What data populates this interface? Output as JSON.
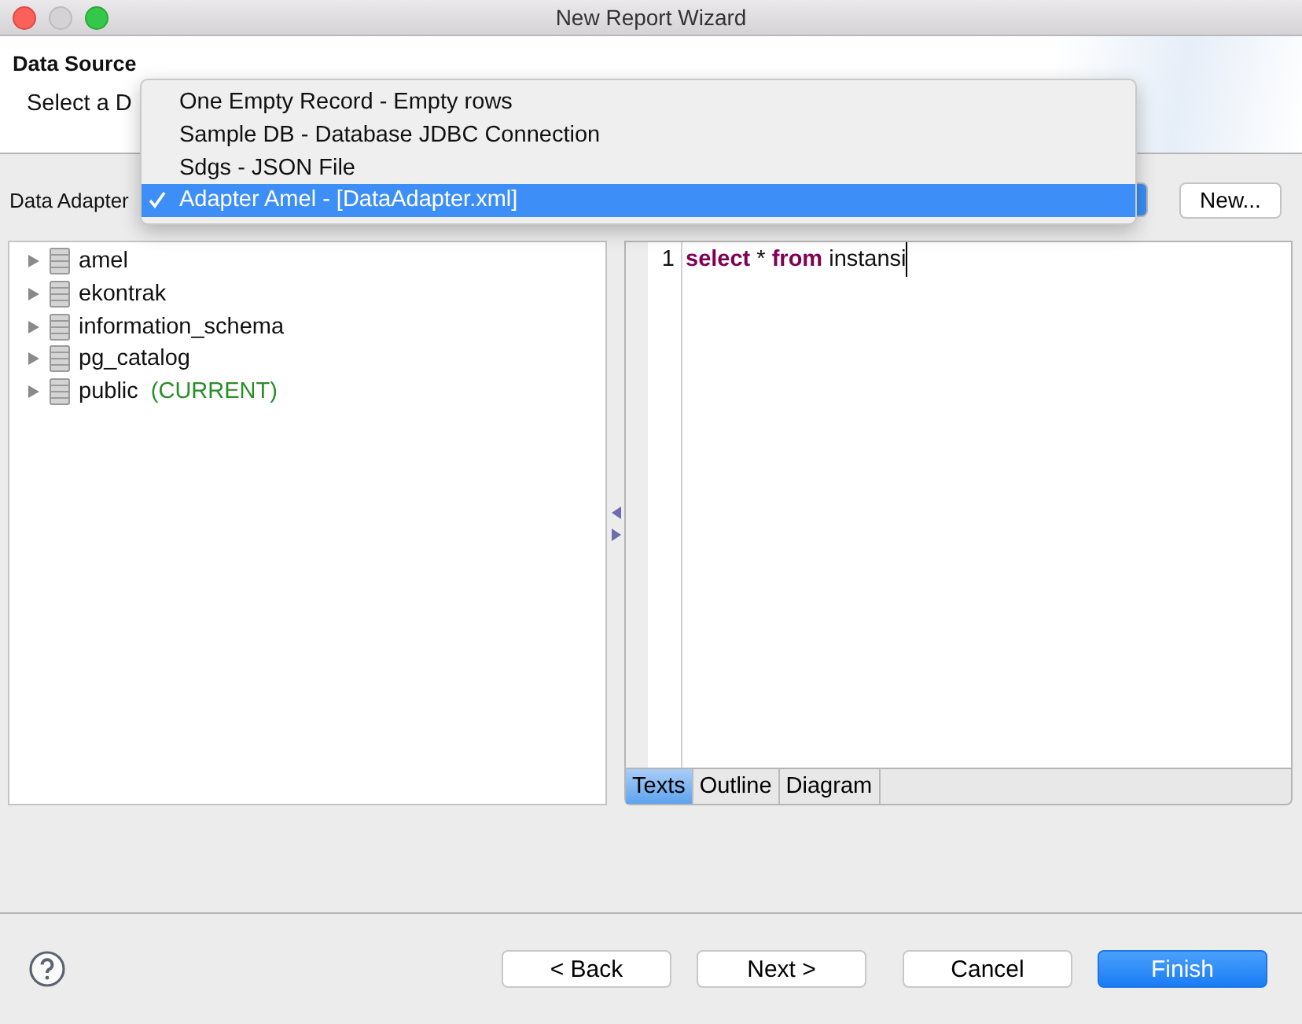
{
  "window": {
    "title": "New Report Wizard"
  },
  "header": {
    "title": "Data Source",
    "subtitle": "Select a D"
  },
  "adapter": {
    "label": "Data Adapter",
    "new_button": "New..."
  },
  "dropdown_menu": {
    "items": [
      {
        "label": "One Empty Record - Empty rows",
        "selected": false
      },
      {
        "label": "Sample DB - Database JDBC Connection",
        "selected": false
      },
      {
        "label": "Sdgs - JSON File",
        "selected": false
      },
      {
        "label": "Adapter Amel - [DataAdapter.xml]",
        "selected": true
      }
    ]
  },
  "schema_tree": {
    "items": [
      {
        "name": "amel",
        "expanded": false
      },
      {
        "name": "ekontrak",
        "expanded": false
      },
      {
        "name": "information_schema",
        "expanded": false
      },
      {
        "name": "pg_catalog",
        "expanded": false
      },
      {
        "name": "public",
        "tag": "(CURRENT)",
        "expanded": false
      }
    ]
  },
  "editor": {
    "lines": [
      {
        "number": "1",
        "tokens": [
          {
            "kind": "keyword",
            "text": "select"
          },
          {
            "kind": "text",
            "text": "*"
          },
          {
            "kind": "keyword",
            "text": "from"
          },
          {
            "kind": "text",
            "text": "instansi"
          }
        ]
      }
    ],
    "tabs": [
      {
        "label": "Texts",
        "selected": true
      },
      {
        "label": "Outline",
        "selected": false
      },
      {
        "label": "Diagram",
        "selected": false
      }
    ]
  },
  "buttons": [
    {
      "label": "< Back",
      "kind": "default"
    },
    {
      "label": "Next >",
      "kind": "default"
    },
    {
      "label": "Cancel",
      "kind": "default"
    },
    {
      "label": "Finish",
      "kind": "primary"
    }
  ]
}
